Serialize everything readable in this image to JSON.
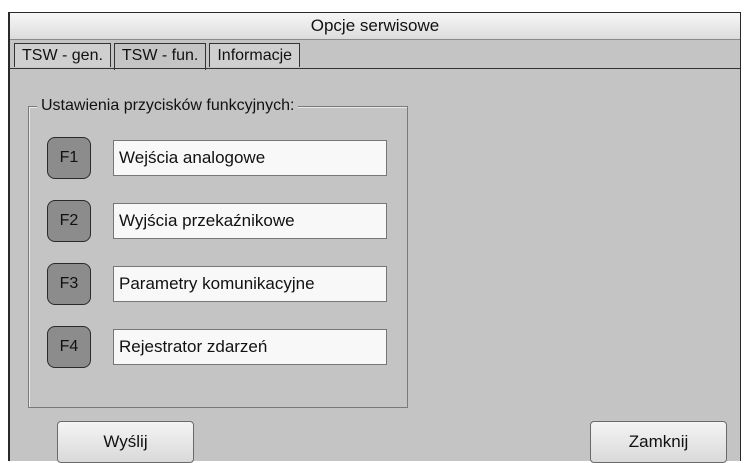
{
  "window": {
    "title": "Opcje serwisowe"
  },
  "tabs": [
    {
      "label": "TSW - gen.",
      "active": false
    },
    {
      "label": "TSW - fun.",
      "active": true
    },
    {
      "label": "Informacje",
      "active": false
    }
  ],
  "function_keys": {
    "group_title": "Ustawienia przycisków funkcyjnych:",
    "items": [
      {
        "key": "F1",
        "value": "Wejścia analogowe"
      },
      {
        "key": "F2",
        "value": "Wyjścia przekaźnikowe"
      },
      {
        "key": "F3",
        "value": "Parametry komunikacyjne"
      },
      {
        "key": "F4",
        "value": "Rejestrator zdarzeń"
      }
    ]
  },
  "footer": {
    "send_label": "Wyślij",
    "close_label": "Zamknij"
  }
}
